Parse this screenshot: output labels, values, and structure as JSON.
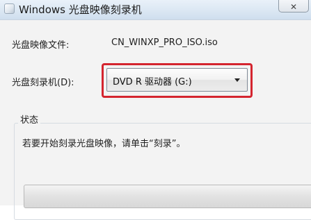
{
  "window": {
    "title": "Windows 光盘映像刻录机",
    "close_label": "✕"
  },
  "form": {
    "image_file_label": "光盘映像文件:",
    "image_file_value": "CN_WINXP_PRO_ISO.iso",
    "burner_label": "光盘刻录机(D):",
    "burner_selected": "DVD R 驱动器 (G:)"
  },
  "status": {
    "group_title": "状态",
    "message": "若要开始刻录光盘映像，请单击“刻录”。",
    "progress": 0
  },
  "colors": {
    "highlight": "#d4252f"
  }
}
